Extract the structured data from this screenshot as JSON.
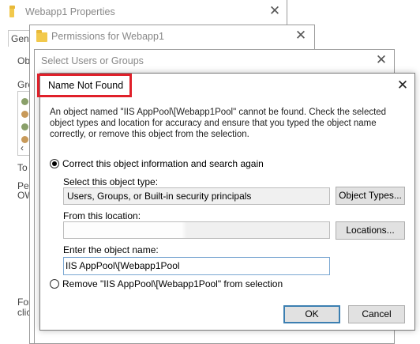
{
  "win_properties": {
    "title": "Webapp1 Properties",
    "tab_general": "Gen",
    "obj_label": "Ob",
    "groups_label": "Gro",
    "to_label": "To",
    "perm_label": "Pe",
    "owner_label": "OW",
    "footer1": "For",
    "footer2": "clic"
  },
  "win_permissions": {
    "title": "Permissions for Webapp1"
  },
  "win_select": {
    "title": "Select Users or Groups"
  },
  "dialog": {
    "title": "Name Not Found",
    "message": "An object named \"IIS AppPool\\[Webapp1Pool\" cannot be found. Check the selected object types and location for accuracy and ensure that you typed the object name correctly, or remove this object from the selection.",
    "option_correct": "Correct this object information and search again",
    "type_label": "Select this object type:",
    "type_value": "Users, Groups, or Built-in security principals",
    "object_types_button": "Object Types...",
    "location_label": "From this location:",
    "location_value": "",
    "locations_button": "Locations...",
    "name_label": "Enter the object name:",
    "name_value": "IIS AppPool\\[Webapp1Pool",
    "option_remove": "Remove \"IIS AppPool\\[Webapp1Pool\" from selection",
    "ok_button": "OK",
    "cancel_button": "Cancel"
  },
  "colors": {
    "highlight_box": "#e0202a",
    "accent": "#3c7fb1"
  }
}
